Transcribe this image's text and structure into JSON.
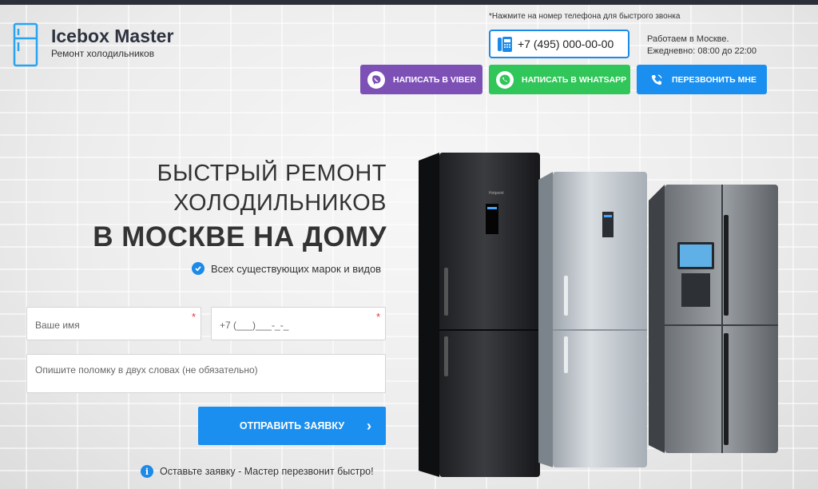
{
  "brand": {
    "title": "Icebox Master",
    "subtitle": "Ремонт холодильников"
  },
  "contact": {
    "call_hint": "*Нажмите на номер телефона для быстрого звонка",
    "phone": "+7 (495) 000-00-00",
    "hours_line1": "Работаем в Москве.",
    "hours_line2": "Ежедневно: 08:00 до 22:00"
  },
  "buttons": {
    "viber": "Написать в Viber",
    "whatsapp": "Написать в WhatsApp",
    "callback": "Перезвонить мне"
  },
  "hero": {
    "line1": "БЫСТРЫЙ РЕМОНТ",
    "line2": "ХОЛОДИЛЬНИКОВ",
    "line3": "В МОСКВЕ НА ДОМУ",
    "feature": "Всех существующих марок и видов"
  },
  "form": {
    "name_placeholder": "Ваше имя",
    "phone_placeholder": "+7 (___)___-_-_",
    "desc_placeholder": "Опишите поломку в двух словах (не обязательно)",
    "required_mark": "*",
    "submit": "ОТПРАВИТЬ ЗАЯВКУ",
    "submit_arrow": "›",
    "note": "Оставьте заявку - Мастер перезвонит быстро!"
  },
  "colors": {
    "accent": "#1a8ff0",
    "viber": "#7d50b6",
    "whatsapp": "#31c659",
    "text": "#333333"
  }
}
